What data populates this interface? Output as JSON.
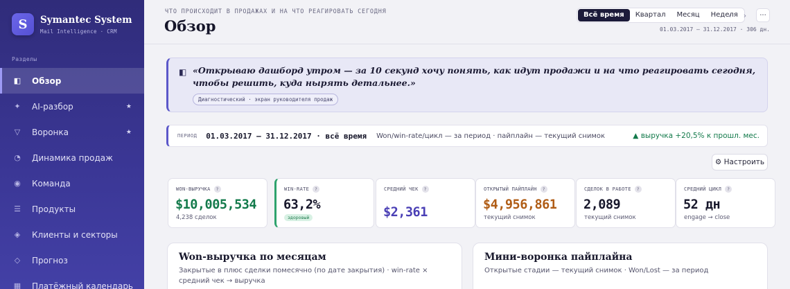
{
  "sidebar": {
    "logo_letter": "S",
    "brand_name": "Symantec System",
    "brand_sub": "Mail Intelligence · CRM",
    "section_label": "Разделы",
    "items": [
      {
        "label": "Обзор",
        "icon": "◧",
        "star": "",
        "active": true
      },
      {
        "label": "AI-разбор",
        "icon": "✦",
        "star": "★",
        "active": false
      },
      {
        "label": "Воронка",
        "icon": "▽",
        "star": "★",
        "active": false
      },
      {
        "label": "Динамика продаж",
        "icon": "◔",
        "star": "",
        "active": false
      },
      {
        "label": "Команда",
        "icon": "◉",
        "star": "",
        "active": false
      },
      {
        "label": "Продукты",
        "icon": "☰",
        "star": "",
        "active": false
      },
      {
        "label": "Клиенты и секторы",
        "icon": "◈",
        "star": "",
        "active": false
      },
      {
        "label": "Прогноз",
        "icon": "◇",
        "star": "",
        "active": false
      },
      {
        "label": "Платёжный календарь",
        "icon": "▦",
        "star": "",
        "active": false
      }
    ]
  },
  "header": {
    "eyebrow": "ЧТО ПРОИСХОДИТ В ПРОДАЖАХ И НА ЧТО РЕАГИРОВАТЬ СЕГОДНЯ",
    "title": "Обзор",
    "periods": [
      "Всё время",
      "Квартал",
      "Месяц",
      "Неделя"
    ],
    "active_period": 0,
    "prev_icon": "‹",
    "next_icon": "›",
    "more_icon": "···",
    "date_range": "01.03.2017 — 31.12.2017 · 306 дн."
  },
  "quote": {
    "icon": "◧",
    "text": "«Открываю дашборд утром — за 10 секунд хочу понять, как идут продажи и на что реагировать сегодня, чтобы решить, куда нырять детальнее.»",
    "tag": "Диагностический · экран руководителя продаж"
  },
  "strip": {
    "label": "ПЕРИОД",
    "range": "01.03.2017 — 31.12.2017 · всё время",
    "note": "Won/win-rate/цикл — за период · пайплайн — текущий снимок",
    "trend": "▲ выручка +20,5% к прошл. мес."
  },
  "config_button": "⚙ Настроить",
  "kpis": [
    {
      "label": "WON-ВЫРУЧКА",
      "value": "$10,005,534",
      "sub": "4,238 сделок",
      "badge": "",
      "color": "#137a4b"
    },
    {
      "label": "WIN-RATE",
      "value": "63,2%",
      "sub": "",
      "badge": "здоровый",
      "color": "#17172b"
    },
    {
      "label": "СРЕДНИЙ ЧЕК",
      "value": "$2,361",
      "sub": "",
      "badge": "",
      "color": "#4a3fb5"
    },
    {
      "label": "ОТКРЫТЫЙ ПАЙПЛАЙН",
      "value": "$4,956,861",
      "sub": "текущий снимок",
      "badge": "",
      "color": "#b05d16"
    },
    {
      "label": "СДЕЛОК В РАБОТЕ",
      "value": "2,089",
      "sub": "текущий снимок",
      "badge": "",
      "color": "#17172b"
    },
    {
      "label": "СРЕДНИЙ ЦИКЛ",
      "value": "52 дн",
      "sub": "engage → close",
      "badge": "",
      "color": "#17172b"
    }
  ],
  "panels": [
    {
      "title": "Won-выручка по месяцам",
      "subtitle": "Закрытые в плюс сделки помесячно (по дате закрытия) · win-rate × средний чек → выручка"
    },
    {
      "title": "Мини-воронка пайплайна",
      "subtitle": "Открытые стадии — текущий снимок · Won/Lost — за период"
    }
  ]
}
